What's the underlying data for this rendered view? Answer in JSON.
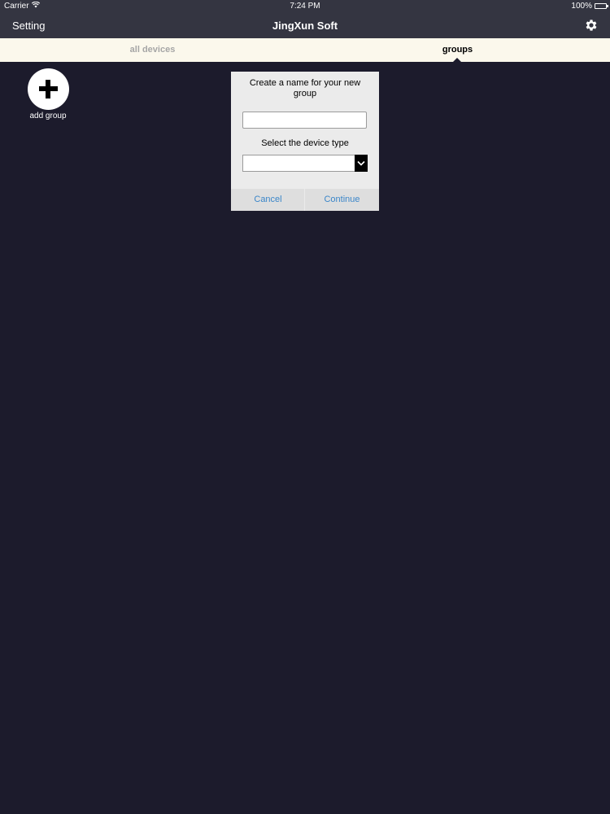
{
  "status_bar": {
    "carrier": "Carrier",
    "time": "7:24 PM",
    "battery": "100%",
    "icons": [
      "wifi-icon",
      "battery-icon"
    ]
  },
  "navbar": {
    "left_label": "Setting",
    "title": "JingXun Soft",
    "right_icon": "gear-icon"
  },
  "tabs": {
    "items": [
      {
        "label": "all devices",
        "selected": false
      },
      {
        "label": "groups",
        "selected": true
      }
    ]
  },
  "add_group": {
    "icon": "plus-icon",
    "label": "add group"
  },
  "dialog": {
    "title": "Create a name for your new group",
    "name_value": "",
    "name_placeholder": "",
    "device_type_label": "Select the device type",
    "device_type_value": "",
    "cancel_label": "Cancel",
    "continue_label": "Continue"
  },
  "colors": {
    "background": "#1c1b2c",
    "navbar": "#343541",
    "tab_bar": "#fbf8ec",
    "dialog": "#ebebeb",
    "button_text": "#3b86c9"
  }
}
